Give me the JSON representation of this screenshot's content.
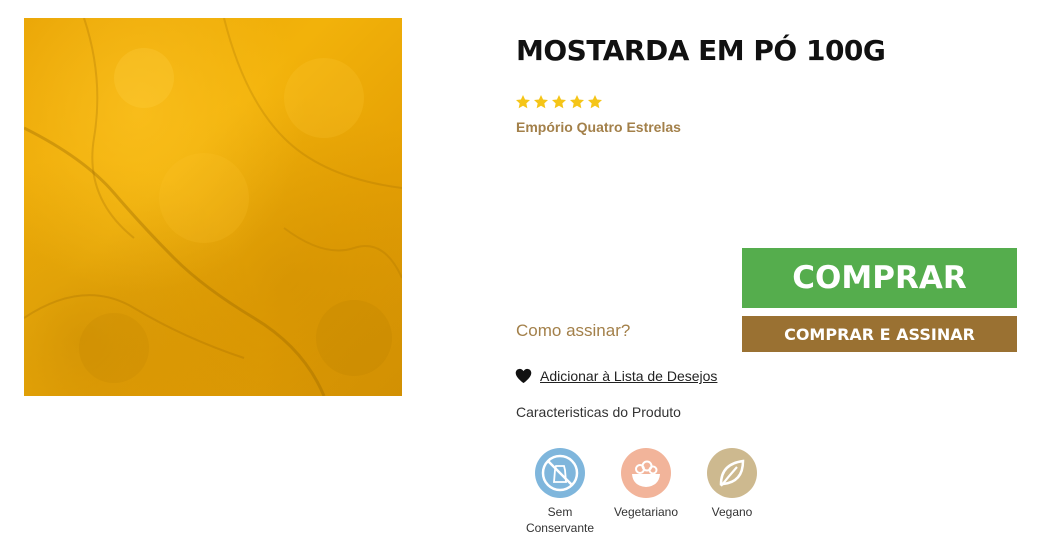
{
  "product": {
    "title": "MOSTARDA EM PÓ 100G",
    "image_alt": "Mostarda em pó",
    "rating": 5,
    "rating_max": 5,
    "brand": "Empório Quatro Estrelas"
  },
  "actions": {
    "how_to_subscribe": "Como assinar?",
    "buy_label": "COMPRAR",
    "buy_subscribe_label": "COMPRAR E ASSINAR",
    "wishlist_label": "Adicionar à Lista de Desejos"
  },
  "features": {
    "title": "Caracteristicas do Produto",
    "items": [
      {
        "label_line1": "Sem",
        "label_line2": "Conservante",
        "icon": "no-preservative-icon",
        "color": "#7fb6dc"
      },
      {
        "label_line1": "Vegetariano",
        "label_line2": "",
        "icon": "salad-bowl-icon",
        "color": "#f2b49a"
      },
      {
        "label_line1": "Vegano",
        "label_line2": "",
        "icon": "leaf-icon",
        "color": "#cdb98f"
      }
    ]
  },
  "colors": {
    "buy_button": "#55ad4d",
    "subscribe_button": "#9a7132",
    "brand_text": "#a3804a",
    "star": "#f5c518"
  }
}
